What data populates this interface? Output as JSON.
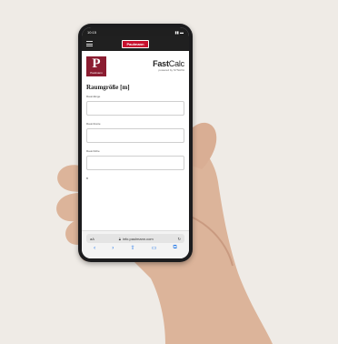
{
  "status_bar": {
    "time": "10:15",
    "icons": "signal-battery-icons"
  },
  "top_bar": {
    "brand": "Paulmann",
    "menu_icon": "hamburger-menu-icon"
  },
  "logo": {
    "letter": "P",
    "sub": "Paulmann"
  },
  "fastcalc": {
    "bold": "Fast",
    "light": "Calc",
    "tagline": "powered by SYNAXA"
  },
  "form": {
    "title": "Raumgröße [m]",
    "fields": [
      {
        "label": "Raumlänge",
        "value": ""
      },
      {
        "label": "Raumbreite",
        "value": ""
      },
      {
        "label": "Raumhöhe",
        "value": ""
      }
    ],
    "extra_label": "B"
  },
  "browser": {
    "aa": "aA",
    "url": "info.paulmann.com",
    "lock_icon": "lock-icon",
    "reload_icon": "reload-icon",
    "nav": {
      "back": "‹",
      "forward": "›",
      "share": "⇧",
      "bookmarks": "▭",
      "tabs": "⧉"
    }
  },
  "colors": {
    "background": "#efebe6",
    "brand_red": "#c8102e",
    "logo_maroon": "#8b1d31",
    "link_blue": "#1a73e8"
  }
}
